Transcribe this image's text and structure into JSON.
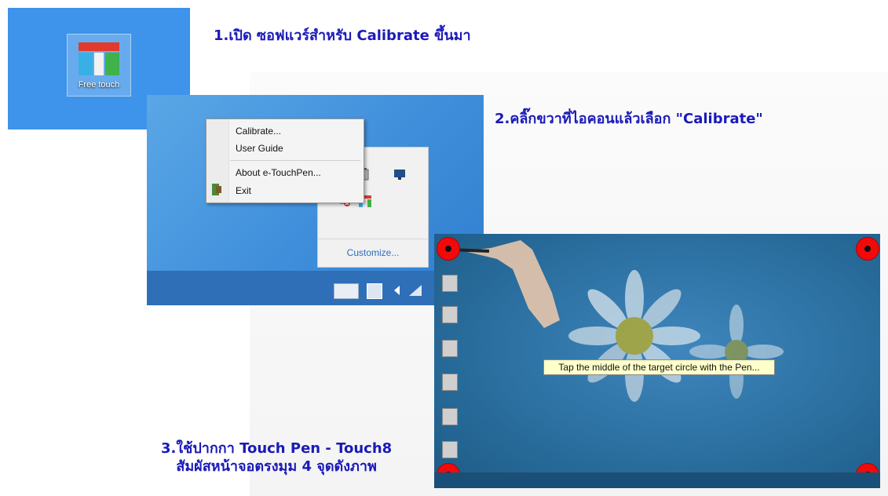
{
  "step1": {
    "text": "1.เปิด ซอฟแวร์สำหรับ Calibrate ขึ้นมา",
    "app_icon_label": "Free touch",
    "app_icon": "free-touch-logo-icon"
  },
  "step2": {
    "text": "2.คลิ๊กขวาที่ไอคอนแล้วเลือก \"Calibrate\"",
    "context_menu": [
      "Calibrate...",
      "User Guide",
      "About e-TouchPen...",
      "Exit"
    ],
    "tray_customize": "Customize..."
  },
  "step3": {
    "line1": "3.ใช้ปากกา Touch Pen - Touch8",
    "line2": "สัมผัสหน้าจอตรงมุม 4 จุดดังภาพ",
    "tooltip": "Tap the middle of the target circle with the Pen..."
  },
  "colors": {
    "step_text": "#1a1ab8",
    "desktop_blue": "#3d94ea",
    "target_red": "#f20a0a",
    "tooltip_bg": "#ffffcc"
  }
}
